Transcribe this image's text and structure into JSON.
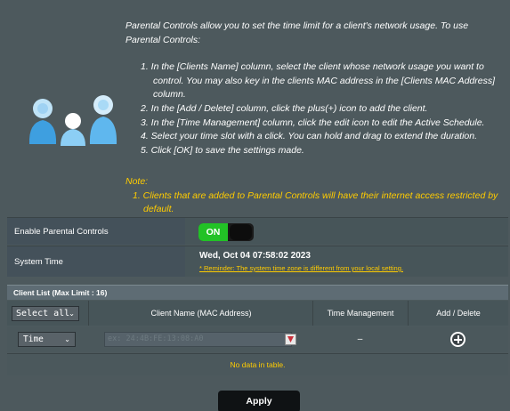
{
  "intro": {
    "text": "Parental Controls allow you to set the time limit for a client's network usage. To use Parental Controls:",
    "steps": [
      "1. In the [Clients Name] column, select the client whose network usage you want to control. You may also key in the clients MAC address in the [Clients MAC Address] column.",
      "2. In the [Add / Delete] column, click the plus(+) icon to add the client.",
      "3. In the [Time Management] column, click the edit icon to edit the Active Schedule.",
      "4. Select your time slot with a click. You can hold and drag to extend the duration.",
      "5. Click [OK] to save the settings made."
    ],
    "note_label": "Note:",
    "note_item": "1. Clients that are added to Parental Controls will have their internet access restricted by default."
  },
  "settings": {
    "enable_label": "Enable Parental Controls",
    "toggle_on": "ON",
    "system_time_label": "System Time",
    "system_time_value": "Wed, Oct 04 07:58:02 2023",
    "reminder": "* Reminder: The system time zone is different from your local setting."
  },
  "client_list": {
    "title": "Client List (Max Limit : 16)",
    "select_all": "Select all",
    "col_name": "Client Name (MAC Address)",
    "col_time": "Time Management",
    "col_add": "Add / Delete",
    "time_select": "Time",
    "mac_placeholder": "ex: 24:4B:FE:13:08:A0",
    "time_dash": "–",
    "no_data": "No data in table."
  },
  "actions": {
    "apply": "Apply"
  },
  "colors": {
    "background": "#4d595d",
    "note": "#ffcc00",
    "toggle_on": "#22c226"
  }
}
